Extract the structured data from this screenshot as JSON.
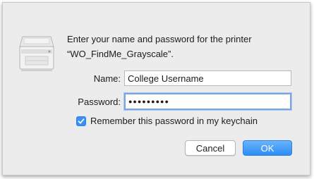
{
  "dialog": {
    "message_line1": "Enter your name and password for the printer",
    "message_line2": "“WO_FindMe_Grayscale”.",
    "icon": "printer-icon"
  },
  "fields": {
    "name_label": "Name:",
    "name_value": "College Username",
    "password_label": "Password:",
    "password_value": "●●●●●●●●●"
  },
  "options": {
    "remember_label": "Remember this password in my keychain",
    "remember_checked": true
  },
  "buttons": {
    "cancel_label": "Cancel",
    "ok_label": "OK"
  },
  "colors": {
    "accent": "#3b8ff6",
    "background": "#ececec"
  }
}
